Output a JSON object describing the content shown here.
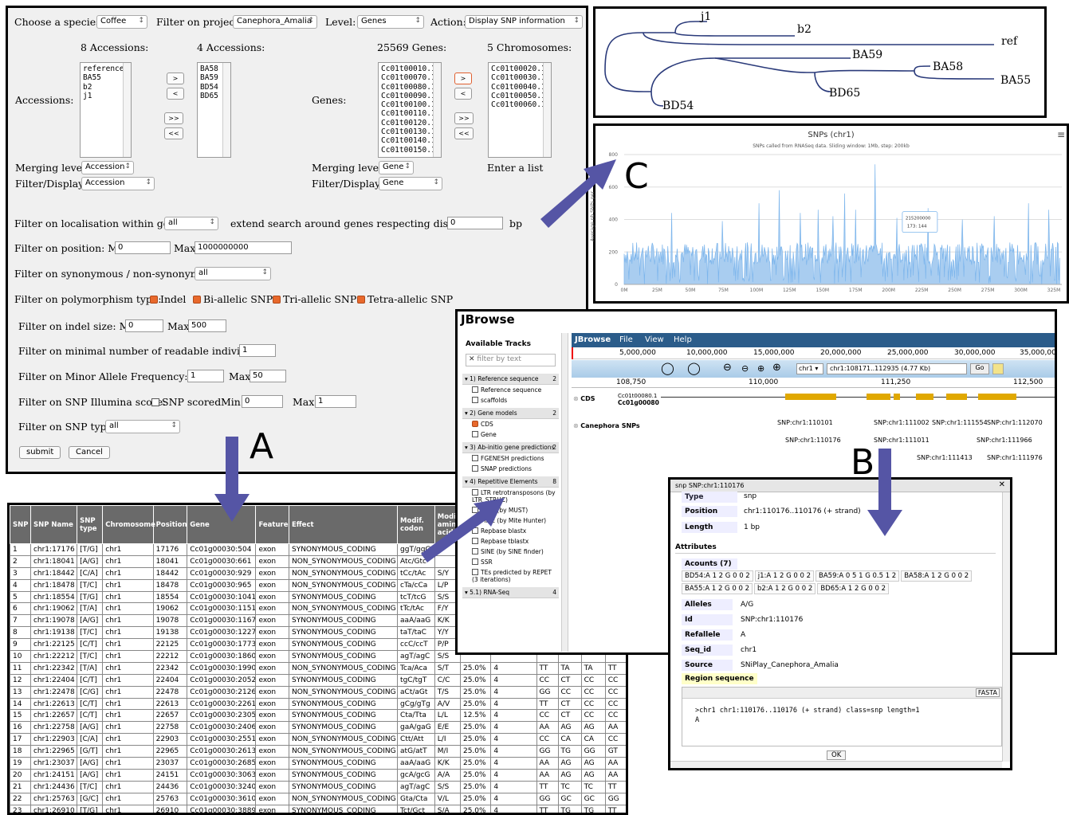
{
  "form": {
    "species_label": "Choose a species:",
    "species": "Coffee",
    "project_label": "Filter on project:",
    "project": "Canephora_Amalia",
    "level_label": "Level:",
    "level": "Genes",
    "action_label": "Action:",
    "action": "Display SNP information",
    "acc_title1": "8 Accessions:",
    "acc_title2": "4 Accessions:",
    "gene_title1": "25569 Genes:",
    "chr_title": "5 Chromosomes:",
    "accessions_label": "Accessions:",
    "genes_label": "Genes:",
    "acc_list": [
      "reference",
      "BA55",
      "b2",
      "j1"
    ],
    "acc_selected": [
      "BA58",
      "BA59",
      "BD54",
      "BD65"
    ],
    "genes_list": [
      "Cc01t00010.1",
      "Cc01t00070.1",
      "Cc01t00080.1",
      "Cc01t00090.1",
      "Cc01t00100.1",
      "Cc01t00110.1",
      "Cc01t00120.1",
      "Cc01t00130.1",
      "Cc01t00140.1",
      "Cc01t00150.1"
    ],
    "chr_list": [
      "Cc01t00020.1",
      "Cc01t00030.1",
      "Cc01t00040.1",
      "Cc01t00050.1",
      "Cc01t00060.1"
    ],
    "btn_right": ">",
    "btn_left": "<",
    "btn_all_right": ">>",
    "btn_all_left": "<<",
    "merge_label": "Merging level:",
    "merge_acc": "Accession",
    "merge_gene": "Gene",
    "filter_disp_label": "Filter/Display:",
    "fd_acc": "Accession",
    "fd_gene": "Gene",
    "enter_list": "Enter a list",
    "loc_label": "Filter on localisation within gene:",
    "loc_value": "all",
    "extend_label": "extend search around genes respecting distance",
    "extend_value": "0",
    "bp": "bp",
    "pos_label": "Filter on position: Min",
    "pos_min": "0",
    "max_label": "Max",
    "pos_max": "1000000000",
    "syn_label": "Filter on synonymous / non-synonymous:",
    "syn_value": "all",
    "poly_label": "Filter on polymorphism type:",
    "poly": [
      "Indel",
      "Bi-allelic SNP",
      "Tri-allelic SNP",
      "Tetra-allelic SNP"
    ],
    "indel_label": "Filter on indel size: Min",
    "indel_min": "0",
    "indel_max": "500",
    "readable_label": "Filter on minimal number of readable individuals:",
    "readable_value": "1",
    "maf_label": "Filter on Minor Allele Frequency: Min",
    "maf_min": "1",
    "maf_max": "50",
    "illumina_label": "Filter on SNP Illumina score:",
    "snp_scored": "SNP scored",
    "min_label": "Min",
    "ill_min": "0",
    "ill_max": "1",
    "type_label": "Filter on SNP type:",
    "type_value": "all",
    "submit": "submit",
    "cancel": "Cancel"
  },
  "tree": {
    "leaves": [
      "j1",
      "b2",
      "ref",
      "BA59",
      "BA58",
      "BA55",
      "BD65",
      "BD54"
    ]
  },
  "chart_data": {
    "type": "area",
    "title": "SNPs (chr1)",
    "subtitle": "SNPs called from RNASeq data. Sliding window: 1Mb, step: 200kb",
    "ylabel": "Average nb SNPs per",
    "x_ticks": [
      "0M",
      "25M",
      "50M",
      "75M",
      "100M",
      "125M",
      "150M",
      "175M",
      "200M",
      "225M",
      "250M",
      "275M",
      "300M",
      "325M"
    ],
    "y_ticks": [
      "0",
      "200",
      "400",
      "600",
      "800"
    ],
    "ylim": [
      0,
      800
    ],
    "tooltip": {
      "x": "215200000",
      "value": "173: 144"
    },
    "peaks": [
      {
        "x": 36,
        "y": 440
      },
      {
        "x": 74,
        "y": 390
      },
      {
        "x": 102,
        "y": 500
      },
      {
        "x": 117,
        "y": 580
      },
      {
        "x": 133,
        "y": 440
      },
      {
        "x": 147,
        "y": 460
      },
      {
        "x": 158,
        "y": 420
      },
      {
        "x": 167,
        "y": 560
      },
      {
        "x": 175,
        "y": 460
      },
      {
        "x": 190,
        "y": 740
      },
      {
        "x": 206,
        "y": 410
      },
      {
        "x": 230,
        "y": 470
      },
      {
        "x": 256,
        "y": 400
      },
      {
        "x": 280,
        "y": 420
      },
      {
        "x": 306,
        "y": 500
      },
      {
        "x": 321,
        "y": 460
      }
    ],
    "color": "#7cb5ec"
  },
  "letters": {
    "a": "A",
    "b": "B",
    "c": "C"
  },
  "table": {
    "headers": [
      "SNP",
      "SNP Name",
      "SNP type",
      "Chromosome",
      "Position",
      "Gene",
      "Feature",
      "Effect",
      "Modif. codon",
      "Modif. amino acid",
      "",
      "",
      "",
      "",
      "",
      ""
    ],
    "rows": [
      [
        "1",
        "chr1:17176",
        "[T/G]",
        "chr1",
        "17176",
        "Cc01g00030:504",
        "exon",
        "SYNONYMOUS_CODING",
        "ggT/ggG",
        "",
        "",
        "",
        "",
        "",
        "",
        ""
      ],
      [
        "2",
        "chr1:18041",
        "[A/G]",
        "chr1",
        "18041",
        "Cc01g00030:661",
        "exon",
        "NON_SYNONYMOUS_CODING",
        "Atc/Gtc",
        "",
        "",
        "",
        "",
        "",
        "",
        ""
      ],
      [
        "3",
        "chr1:18442",
        "[C/A]",
        "chr1",
        "18442",
        "Cc01g00030:929",
        "exon",
        "NON_SYNONYMOUS_CODING",
        "tCc/tAc",
        "S/Y",
        "",
        "",
        "",
        "",
        "",
        ""
      ],
      [
        "4",
        "chr1:18478",
        "[T/C]",
        "chr1",
        "18478",
        "Cc01g00030:965",
        "exon",
        "NON_SYNONYMOUS_CODING",
        "cTa/cCa",
        "L/P",
        "",
        "",
        "",
        "",
        "",
        ""
      ],
      [
        "5",
        "chr1:18554",
        "[T/G]",
        "chr1",
        "18554",
        "Cc01g00030:1041",
        "exon",
        "SYNONYMOUS_CODING",
        "tcT/tcG",
        "S/S",
        "",
        "",
        "",
        "",
        "",
        ""
      ],
      [
        "6",
        "chr1:19062",
        "[T/A]",
        "chr1",
        "19062",
        "Cc01g00030:1151",
        "exon",
        "NON_SYNONYMOUS_CODING",
        "tTc/tAc",
        "F/Y",
        "",
        "",
        "",
        "",
        "",
        ""
      ],
      [
        "7",
        "chr1:19078",
        "[A/G]",
        "chr1",
        "19078",
        "Cc01g00030:1167",
        "exon",
        "SYNONYMOUS_CODING",
        "aaA/aaG",
        "K/K",
        "",
        "",
        "",
        "",
        "",
        ""
      ],
      [
        "8",
        "chr1:19138",
        "[T/C]",
        "chr1",
        "19138",
        "Cc01g00030:1227",
        "exon",
        "SYNONYMOUS_CODING",
        "taT/taC",
        "Y/Y",
        "",
        "",
        "",
        "",
        "",
        ""
      ],
      [
        "9",
        "chr1:22125",
        "[C/T]",
        "chr1",
        "22125",
        "Cc01g00030:1773",
        "exon",
        "SYNONYMOUS_CODING",
        "ccC/ccT",
        "P/P",
        "",
        "",
        "",
        "",
        "",
        ""
      ],
      [
        "10",
        "chr1:22212",
        "[T/C]",
        "chr1",
        "22212",
        "Cc01g00030:1860",
        "exon",
        "SYNONYMOUS_CODING",
        "agT/agC",
        "S/S",
        "",
        "",
        "",
        "",
        "",
        ""
      ],
      [
        "11",
        "chr1:22342",
        "[T/A]",
        "chr1",
        "22342",
        "Cc01g00030:1990",
        "exon",
        "NON_SYNONYMOUS_CODING",
        "Tca/Aca",
        "S/T",
        "25.0%",
        "4",
        "TT",
        "TA",
        "TA",
        "TT"
      ],
      [
        "12",
        "chr1:22404",
        "[C/T]",
        "chr1",
        "22404",
        "Cc01g00030:2052",
        "exon",
        "SYNONYMOUS_CODING",
        "tgC/tgT",
        "C/C",
        "25.0%",
        "4",
        "CC",
        "CT",
        "CC",
        "CC"
      ],
      [
        "13",
        "chr1:22478",
        "[C/G]",
        "chr1",
        "22478",
        "Cc01g00030:2126",
        "exon",
        "NON_SYNONYMOUS_CODING",
        "aCt/aGt",
        "T/S",
        "25.0%",
        "4",
        "GG",
        "CC",
        "CC",
        "CC"
      ],
      [
        "14",
        "chr1:22613",
        "[C/T]",
        "chr1",
        "22613",
        "Cc01g00030:2261",
        "exon",
        "SYNONYMOUS_CODING",
        "gCg/gTg",
        "A/V",
        "25.0%",
        "4",
        "TT",
        "CT",
        "CC",
        "CC"
      ],
      [
        "15",
        "chr1:22657",
        "[C/T]",
        "chr1",
        "22657",
        "Cc01g00030:2305",
        "exon",
        "SYNONYMOUS_CODING",
        "Cta/Tta",
        "L/L",
        "12.5%",
        "4",
        "CC",
        "CT",
        "CC",
        "CC"
      ],
      [
        "16",
        "chr1:22758",
        "[A/G]",
        "chr1",
        "22758",
        "Cc01g00030:2406",
        "exon",
        "SYNONYMOUS_CODING",
        "gaA/gaG",
        "E/E",
        "25.0%",
        "4",
        "AA",
        "AG",
        "AG",
        "AA"
      ],
      [
        "17",
        "chr1:22903",
        "[C/A]",
        "chr1",
        "22903",
        "Cc01g00030:2551",
        "exon",
        "NON_SYNONYMOUS_CODING",
        "Ctt/Att",
        "L/I",
        "25.0%",
        "4",
        "CC",
        "CA",
        "CA",
        "CC"
      ],
      [
        "18",
        "chr1:22965",
        "[G/T]",
        "chr1",
        "22965",
        "Cc01g00030:2613",
        "exon",
        "NON_SYNONYMOUS_CODING",
        "atG/atT",
        "M/I",
        "25.0%",
        "4",
        "GG",
        "TG",
        "GG",
        "GT"
      ],
      [
        "19",
        "chr1:23037",
        "[A/G]",
        "chr1",
        "23037",
        "Cc01g00030:2685",
        "exon",
        "SYNONYMOUS_CODING",
        "aaA/aaG",
        "K/K",
        "25.0%",
        "4",
        "AA",
        "AG",
        "AG",
        "AA"
      ],
      [
        "20",
        "chr1:24151",
        "[A/G]",
        "chr1",
        "24151",
        "Cc01g00030:3063",
        "exon",
        "SYNONYMOUS_CODING",
        "gcA/gcG",
        "A/A",
        "25.0%",
        "4",
        "AA",
        "AG",
        "AG",
        "AA"
      ],
      [
        "21",
        "chr1:24436",
        "[T/C]",
        "chr1",
        "24436",
        "Cc01g00030:3240",
        "exon",
        "SYNONYMOUS_CODING",
        "agT/agC",
        "S/S",
        "25.0%",
        "4",
        "TT",
        "TC",
        "TC",
        "TT"
      ],
      [
        "22",
        "chr1:25763",
        "[G/C]",
        "chr1",
        "25763",
        "Cc01g00030:3610",
        "exon",
        "NON_SYNONYMOUS_CODING",
        "Gta/Cta",
        "V/L",
        "25.0%",
        "4",
        "GG",
        "GC",
        "GC",
        "GG"
      ],
      [
        "23",
        "chr1:26910",
        "[T/G]",
        "chr1",
        "26910",
        "Cc01g00030:3889",
        "exon",
        "SYNONYMOUS_CODING",
        "Tct/Gct",
        "S/A",
        "25.0%",
        "4",
        "TT",
        "TG",
        "TG",
        "TT"
      ]
    ]
  },
  "jbrowse": {
    "title": "JBrowse",
    "available_tracks": "Available Tracks",
    "filter_placeholder": "filter by text",
    "menu": [
      "JBrowse",
      "File",
      "View",
      "Help"
    ],
    "scale": [
      "5,000,000",
      "10,000,000",
      "15,000,000",
      "20,000,000",
      "25,000,000",
      "30,000,000",
      "35,000,000"
    ],
    "ref": "chr1",
    "location": "chr1:108171..112935 (4.77 Kb)",
    "go": "Go",
    "ruler": [
      "108,750",
      "110,000",
      "111,250",
      "112,500"
    ],
    "cds_track": "CDS",
    "cds_feature1": "Cc01t00080.1",
    "cds_feature2": "Cc01g00080",
    "snp_track": "Canephora SNPs",
    "snps": [
      "SNP:chr1:110101",
      "SNP:chr1:111002",
      "SNP:chr1:111554",
      "SNP:chr1:112070",
      "SNP:chr1:110176",
      "SNP:chr1:111011",
      "SNP:chr1:111966",
      "SNP:chr1:111413",
      "SNP:chr1:111976"
    ],
    "cat1": "1) Reference sequence",
    "cat1_n": "2",
    "cat1_items": [
      "Reference sequence",
      "scaffolds"
    ],
    "cat2": "2) Gene models",
    "cat2_n": "2",
    "cat2_items": [
      "CDS",
      "Gene"
    ],
    "cat3": "3) Ab-initio gene predictions",
    "cat3_n": "2",
    "cat3_items": [
      "FGENESH predictions",
      "SNAP predictions"
    ],
    "cat4": "4) Repetitive Elements",
    "cat4_n": "8",
    "cat4_items": [
      "LTR retrotransposons (by LTR_STRUC)",
      "MITE (by MUST)",
      "MITE (by Mite Hunter)",
      "Repbase blastx",
      "Repbase tblastx",
      "SINE (by SINE finder)",
      "SSR",
      "TEs predicted by REPET (3 iterations)"
    ],
    "cat5": "5.1) RNA-Seq",
    "cat5_n": "4"
  },
  "snp_detail": {
    "title": "snp SNP:chr1:110176",
    "type_label": "Type",
    "type_value": "snp",
    "position_label": "Position",
    "position_value": "chr1:110176..110176 (+ strand)",
    "length_label": "Length",
    "length_value": "1 bp",
    "attributes": "Attributes",
    "acounts": "Acounts (7)",
    "acount_items": [
      "BD54:A 1 2 G 0 0 2",
      "j1:A 1 2 G 0 0 2",
      "BA59:A 0 5 1 G 0.5 1 2",
      "BA58:A 1 2 G 0 0 2",
      "BA55:A 1 2 G 0 0 2",
      "b2:A 1 2 G 0 0 2",
      "BD65:A 1 2 G 0 0 2"
    ],
    "alleles_label": "Alleles",
    "alleles_value": "A/G",
    "id_label": "Id",
    "id_value": "SNP:chr1:110176",
    "refallele_label": "Refallele",
    "refallele_value": "A",
    "seqid_label": "Seq_id",
    "seqid_value": "chr1",
    "source_label": "Source",
    "source_value": "SNiPlay_Canephora_Amalia",
    "region_label": "Region sequence",
    "fasta": "FASTA",
    "seq_line1": ">chr1 chr1:110176..110176 (+ strand) class=snp length=1",
    "seq_line2": "A",
    "ok": "OK"
  }
}
